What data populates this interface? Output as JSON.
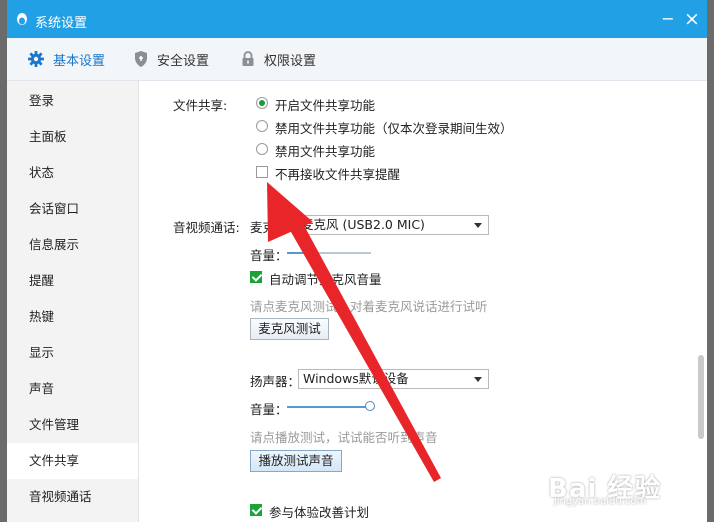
{
  "window": {
    "title": "系统设置",
    "minimize_glyph": "−",
    "close_glyph": "×"
  },
  "tabs": [
    {
      "label": "基本设置",
      "icon": "gear-icon",
      "active": true
    },
    {
      "label": "安全设置",
      "icon": "shield-icon",
      "active": false
    },
    {
      "label": "权限设置",
      "icon": "lock-icon",
      "active": false
    }
  ],
  "sidebar": {
    "items": [
      {
        "label": "登录"
      },
      {
        "label": "主面板"
      },
      {
        "label": "状态"
      },
      {
        "label": "会话窗口"
      },
      {
        "label": "信息展示"
      },
      {
        "label": "提醒"
      },
      {
        "label": "热键"
      },
      {
        "label": "显示"
      },
      {
        "label": "声音"
      },
      {
        "label": "文件管理"
      },
      {
        "label": "文件共享",
        "active": true
      },
      {
        "label": "音视频通话"
      }
    ]
  },
  "file_share": {
    "section_label": "文件共享:",
    "options": [
      {
        "label": "开启文件共享功能",
        "selected": true
      },
      {
        "label": "禁用文件共享功能（仅本次登录期间生效）",
        "selected": false
      },
      {
        "label": "禁用文件共享功能",
        "selected": false
      }
    ],
    "no_reminder_label": "不再接收文件共享提醒",
    "no_reminder_checked": false
  },
  "av_call": {
    "section_label": "音视频通话:",
    "mic_label": "麦克风:",
    "mic_value": "麦克风 (USB2.0 MIC)",
    "mic_volume_label": "音量：",
    "mic_volume_level": 0.3,
    "auto_adjust_label": "自动调节麦克风音量",
    "auto_adjust_checked": true,
    "mic_test_hint": "请点麦克风测试，对着麦克风说话进行试听",
    "mic_test_button": "麦克风测试",
    "speaker_label": "扬声器：",
    "speaker_value": "Windows默认设备",
    "speaker_volume_label": "音量：",
    "speaker_volume_level": 1.0,
    "speaker_test_hint": "请点播放测试，试试能否听到声音",
    "speaker_test_button": "播放测试声音",
    "improve_label": "参与体验改善计划",
    "improve_checked": true
  },
  "watermark": {
    "main": "Bai 经验",
    "sub": "jingyan.baidu.com"
  },
  "colors": {
    "titlebar": "#22a0e6",
    "accent": "#1a77c9",
    "arrow": "#e8262a",
    "check_green": "#19a339"
  }
}
